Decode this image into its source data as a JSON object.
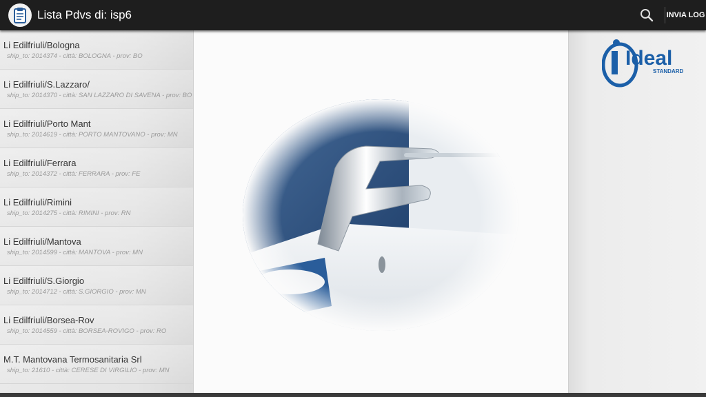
{
  "header": {
    "title": "Lista Pdvs di: isp6",
    "app_icon": "clipboard-icon",
    "search_icon": "search-icon",
    "action_label": "INVIA LOG"
  },
  "list": {
    "items": [
      {
        "name": "Li Edilfriuli/Bologna",
        "detail": "ship_to: 2014374 - città: BOLOGNA - prov: BO"
      },
      {
        "name": "Li Edilfriuli/S.Lazzaro/",
        "detail": "ship_to: 2014370 - città: SAN LAZZARO DI SAVENA - prov: BO"
      },
      {
        "name": "Li Edilfriuli/Porto Mant",
        "detail": "ship_to: 2014619 - città: PORTO MANTOVANO - prov: MN"
      },
      {
        "name": "Li Edilfriuli/Ferrara",
        "detail": "ship_to: 2014372 - città: FERRARA - prov: FE"
      },
      {
        "name": "Li Edilfriuli/Rimini",
        "detail": "ship_to: 2014275 - città: RIMINI - prov: RN"
      },
      {
        "name": "Li Edilfriuli/Mantova",
        "detail": "ship_to: 2014599 - città: MANTOVA - prov: MN"
      },
      {
        "name": "Li Edilfriuli/S.Giorgio",
        "detail": "ship_to: 2014712 - città: S.GIORGIO - prov: MN"
      },
      {
        "name": "Li Edilfriuli/Borsea-Rov",
        "detail": "ship_to: 2014559 - città: BORSEA-ROVIGO - prov: RO"
      },
      {
        "name": "M.T. Mantovana Termosanitaria Srl",
        "detail": "ship_to: 21610 - città: CERESE DI VIRGILIO - prov: MN"
      }
    ]
  },
  "logo": {
    "brand_word": "Ideal",
    "brand_sub": "STANDARD",
    "color": "#1b5fa8"
  },
  "colors": {
    "topbar": "#1e1e1e",
    "accent_blue": "#2a5d9a"
  }
}
